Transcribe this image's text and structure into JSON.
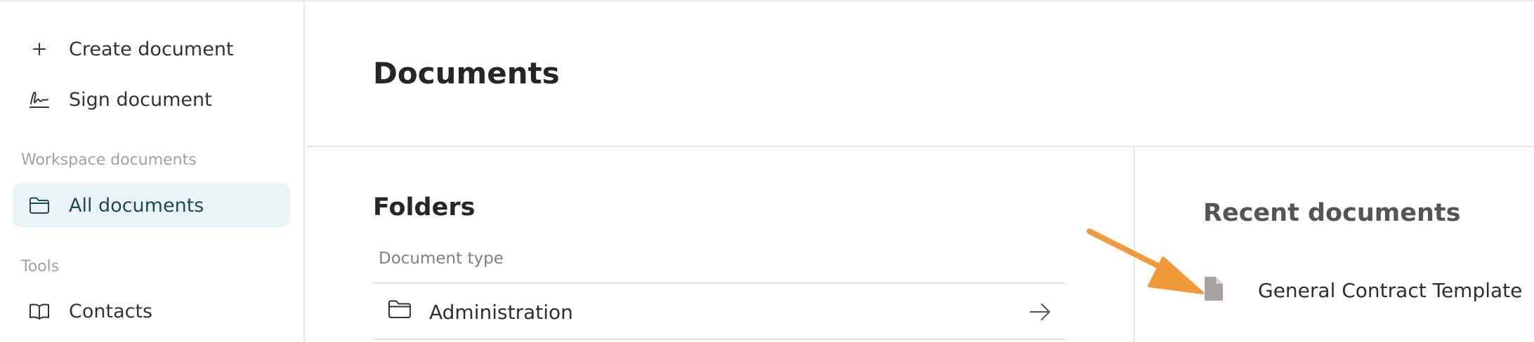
{
  "sidebar": {
    "actions": [
      {
        "label": "Create document",
        "icon": "plus-icon"
      },
      {
        "label": "Sign document",
        "icon": "signature-icon"
      }
    ],
    "workspace_section": "Workspace documents",
    "workspace_items": [
      {
        "label": "All documents",
        "icon": "folder-icon",
        "active": true
      }
    ],
    "tools_section": "Tools",
    "tools_items": [
      {
        "label": "Contacts",
        "icon": "book-icon"
      }
    ]
  },
  "main": {
    "title": "Documents",
    "folders": {
      "title": "Folders",
      "column_header": "Document type",
      "rows": [
        {
          "label": "Administration",
          "icon": "folder-icon",
          "action_icon": "arrow-right-icon"
        }
      ]
    },
    "recent": {
      "title": "Recent documents",
      "items": [
        {
          "label": "General Contract Template",
          "icon": "document-icon"
        }
      ]
    }
  },
  "colors": {
    "active_bg": "#eaf4f6",
    "annotation_arrow": "#f09a3a",
    "document_icon": "#a8a29e"
  }
}
